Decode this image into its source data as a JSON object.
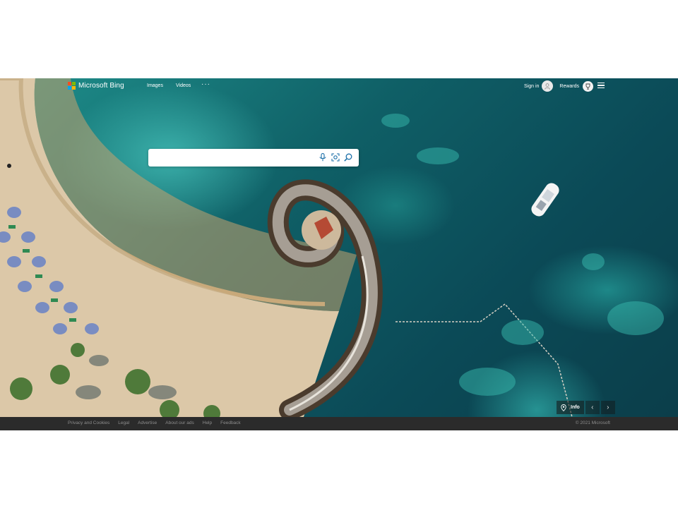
{
  "brand": {
    "name": "Microsoft Bing",
    "logo_colors": [
      "#f25022",
      "#7fba00",
      "#00a4ef",
      "#ffb900"
    ]
  },
  "nav": {
    "items": [
      {
        "label": "Images"
      },
      {
        "label": "Videos"
      }
    ],
    "more": "···"
  },
  "account": {
    "signin_label": "Sign in",
    "rewards_label": "Rewards"
  },
  "search": {
    "value": "",
    "placeholder": "",
    "voice_icon": "microphone-icon",
    "visual_icon": "visual-search-icon",
    "submit_icon": "search-icon"
  },
  "image_info": {
    "info_label": "Info",
    "prev_icon": "chevron-left-icon",
    "next_icon": "chevron-right-icon"
  },
  "footer": {
    "links": [
      {
        "label": "Privacy and Cookies"
      },
      {
        "label": "Legal"
      },
      {
        "label": "Advertise"
      },
      {
        "label": "About our ads"
      },
      {
        "label": "Help"
      },
      {
        "label": "Feedback"
      }
    ],
    "copyright": "© 2021 Microsoft"
  },
  "colors": {
    "footer_bg": "#2b2b2b",
    "search_icon": "#1b6fa8"
  }
}
